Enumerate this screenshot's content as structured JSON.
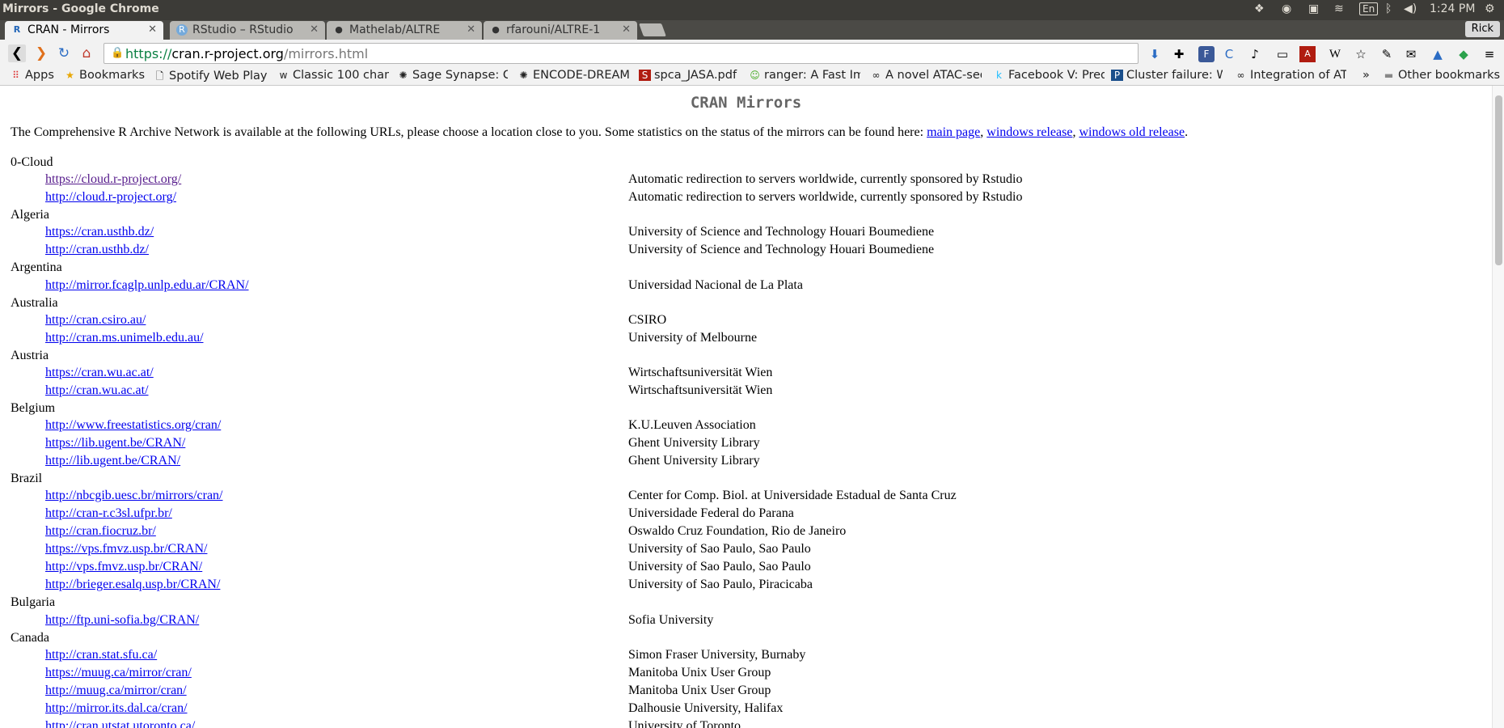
{
  "os": {
    "window_title": "Mirrors - Google Chrome",
    "input_method": "En",
    "clock": "1:24 PM"
  },
  "tabs": [
    {
      "label": "CRAN - Mirrors",
      "favicon": "R",
      "active": true
    },
    {
      "label": "RStudio – RStudio",
      "favicon": "R",
      "active": false
    },
    {
      "label": "Mathelab/ALTRE",
      "favicon": "github",
      "active": false
    },
    {
      "label": "rfarouni/ALTRE-1",
      "favicon": "github",
      "active": false
    }
  ],
  "profile": "Rick",
  "address": {
    "scheme": "https://",
    "host": "cran.r-project.org",
    "path": "/mirrors.html"
  },
  "bookmarks": [
    {
      "label": "Apps",
      "icon": "apps-grid-icon"
    },
    {
      "label": "Bookmarks",
      "icon": "star-icon"
    },
    {
      "label": "Spotify Web Play",
      "icon": "page-icon"
    },
    {
      "label": "Classic 100 cham",
      "icon": "w-icon"
    },
    {
      "label": "Sage Synapse: Co",
      "icon": "synapse-icon"
    },
    {
      "label": "ENCODE-DREAM",
      "icon": "synapse-icon"
    },
    {
      "label": "spca_JASA.pdf",
      "icon": "pdf-icon"
    },
    {
      "label": "ranger: A Fast Im",
      "icon": "face-icon"
    },
    {
      "label": "A novel ATAC-seq",
      "icon": "link-icon"
    },
    {
      "label": "Facebook V: Pred",
      "icon": "k-icon"
    },
    {
      "label": "Cluster failure: W",
      "icon": "pnas-icon"
    },
    {
      "label": "Integration of AT",
      "icon": "link-icon"
    },
    {
      "label": "»",
      "icon": ""
    },
    {
      "label": "Other bookmarks",
      "icon": "folder-icon"
    }
  ],
  "page": {
    "title": "CRAN Mirrors",
    "intro_text": "The Comprehensive R Archive Network is available at the following URLs, please choose a location close to you. Some statistics on the status of the mirrors can be found here: ",
    "intro_links": [
      "main page",
      "windows release",
      "windows old release"
    ],
    "countries": [
      {
        "name": "0-Cloud",
        "mirrors": [
          {
            "url": "https://cloud.r-project.org/",
            "desc": "Automatic redirection to servers worldwide, currently sponsored by Rstudio",
            "visited": true
          },
          {
            "url": "http://cloud.r-project.org/",
            "desc": "Automatic redirection to servers worldwide, currently sponsored by Rstudio"
          }
        ]
      },
      {
        "name": "Algeria",
        "mirrors": [
          {
            "url": "https://cran.usthb.dz/",
            "desc": "University of Science and Technology Houari Boumediene"
          },
          {
            "url": "http://cran.usthb.dz/",
            "desc": "University of Science and Technology Houari Boumediene"
          }
        ]
      },
      {
        "name": "Argentina",
        "mirrors": [
          {
            "url": "http://mirror.fcaglp.unlp.edu.ar/CRAN/",
            "desc": "Universidad Nacional de La Plata"
          }
        ]
      },
      {
        "name": "Australia",
        "mirrors": [
          {
            "url": "http://cran.csiro.au/",
            "desc": "CSIRO"
          },
          {
            "url": "http://cran.ms.unimelb.edu.au/",
            "desc": "University of Melbourne"
          }
        ]
      },
      {
        "name": "Austria",
        "mirrors": [
          {
            "url": "https://cran.wu.ac.at/",
            "desc": "Wirtschaftsuniversität Wien"
          },
          {
            "url": "http://cran.wu.ac.at/",
            "desc": "Wirtschaftsuniversität Wien"
          }
        ]
      },
      {
        "name": "Belgium",
        "mirrors": [
          {
            "url": "http://www.freestatistics.org/cran/",
            "desc": "K.U.Leuven Association"
          },
          {
            "url": "https://lib.ugent.be/CRAN/",
            "desc": "Ghent University Library"
          },
          {
            "url": "http://lib.ugent.be/CRAN/",
            "desc": "Ghent University Library"
          }
        ]
      },
      {
        "name": "Brazil",
        "mirrors": [
          {
            "url": "http://nbcgib.uesc.br/mirrors/cran/",
            "desc": "Center for Comp. Biol. at Universidade Estadual de Santa Cruz"
          },
          {
            "url": "http://cran-r.c3sl.ufpr.br/",
            "desc": "Universidade Federal do Parana"
          },
          {
            "url": "http://cran.fiocruz.br/",
            "desc": "Oswaldo Cruz Foundation, Rio de Janeiro"
          },
          {
            "url": "https://vps.fmvz.usp.br/CRAN/",
            "desc": "University of Sao Paulo, Sao Paulo"
          },
          {
            "url": "http://vps.fmvz.usp.br/CRAN/",
            "desc": "University of Sao Paulo, Sao Paulo"
          },
          {
            "url": "http://brieger.esalq.usp.br/CRAN/",
            "desc": "University of Sao Paulo, Piracicaba"
          }
        ]
      },
      {
        "name": "Bulgaria",
        "mirrors": [
          {
            "url": "http://ftp.uni-sofia.bg/CRAN/",
            "desc": "Sofia University"
          }
        ]
      },
      {
        "name": "Canada",
        "mirrors": [
          {
            "url": "http://cran.stat.sfu.ca/",
            "desc": "Simon Fraser University, Burnaby"
          },
          {
            "url": "https://muug.ca/mirror/cran/",
            "desc": "Manitoba Unix User Group"
          },
          {
            "url": "http://muug.ca/mirror/cran/",
            "desc": "Manitoba Unix User Group"
          },
          {
            "url": "http://mirror.its.dal.ca/cran/",
            "desc": "Dalhousie University, Halifax"
          },
          {
            "url": "http://cran.utstat.utoronto.ca/",
            "desc": "University of Toronto"
          }
        ]
      }
    ]
  },
  "colors": {
    "link": "#0000ee",
    "visited_link": "#551a8b",
    "title_gray": "#666666",
    "os_bar": "#3c3b37"
  }
}
